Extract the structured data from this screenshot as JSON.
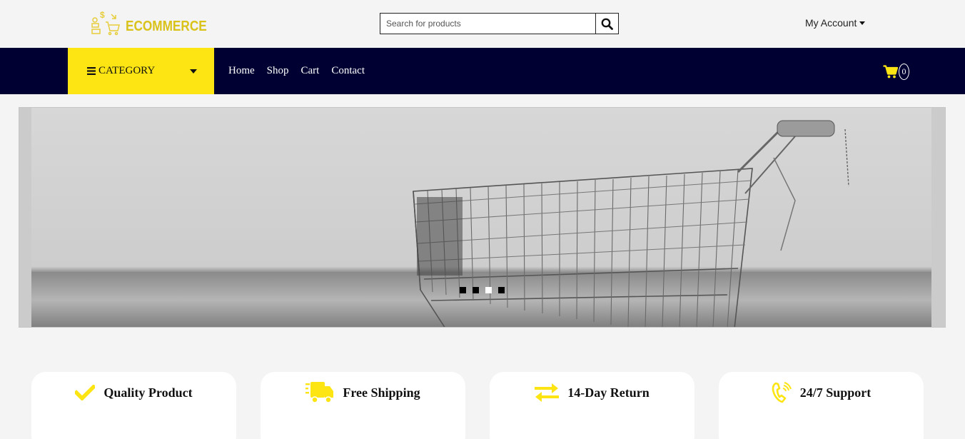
{
  "header": {
    "logo_text": "ECOMMERCE",
    "search_placeholder": "Search for products",
    "account_label": "My Account"
  },
  "nav": {
    "category_label": "CATEGORY",
    "menu": [
      "Home",
      "Shop",
      "Cart",
      "Contact"
    ],
    "cart_count": "0"
  },
  "hero": {
    "slide_count": 4,
    "active_slide": 3
  },
  "features": [
    {
      "label": "Quality Product",
      "icon": "check-icon"
    },
    {
      "label": "Free Shipping",
      "icon": "truck-icon"
    },
    {
      "label": "14-Day Return",
      "icon": "exchange-icon"
    },
    {
      "label": "24/7 Support",
      "icon": "phone-icon"
    }
  ],
  "colors": {
    "accent_yellow": "#fce513",
    "nav_navy": "#000033",
    "logo_gold": "#d9c21a"
  }
}
